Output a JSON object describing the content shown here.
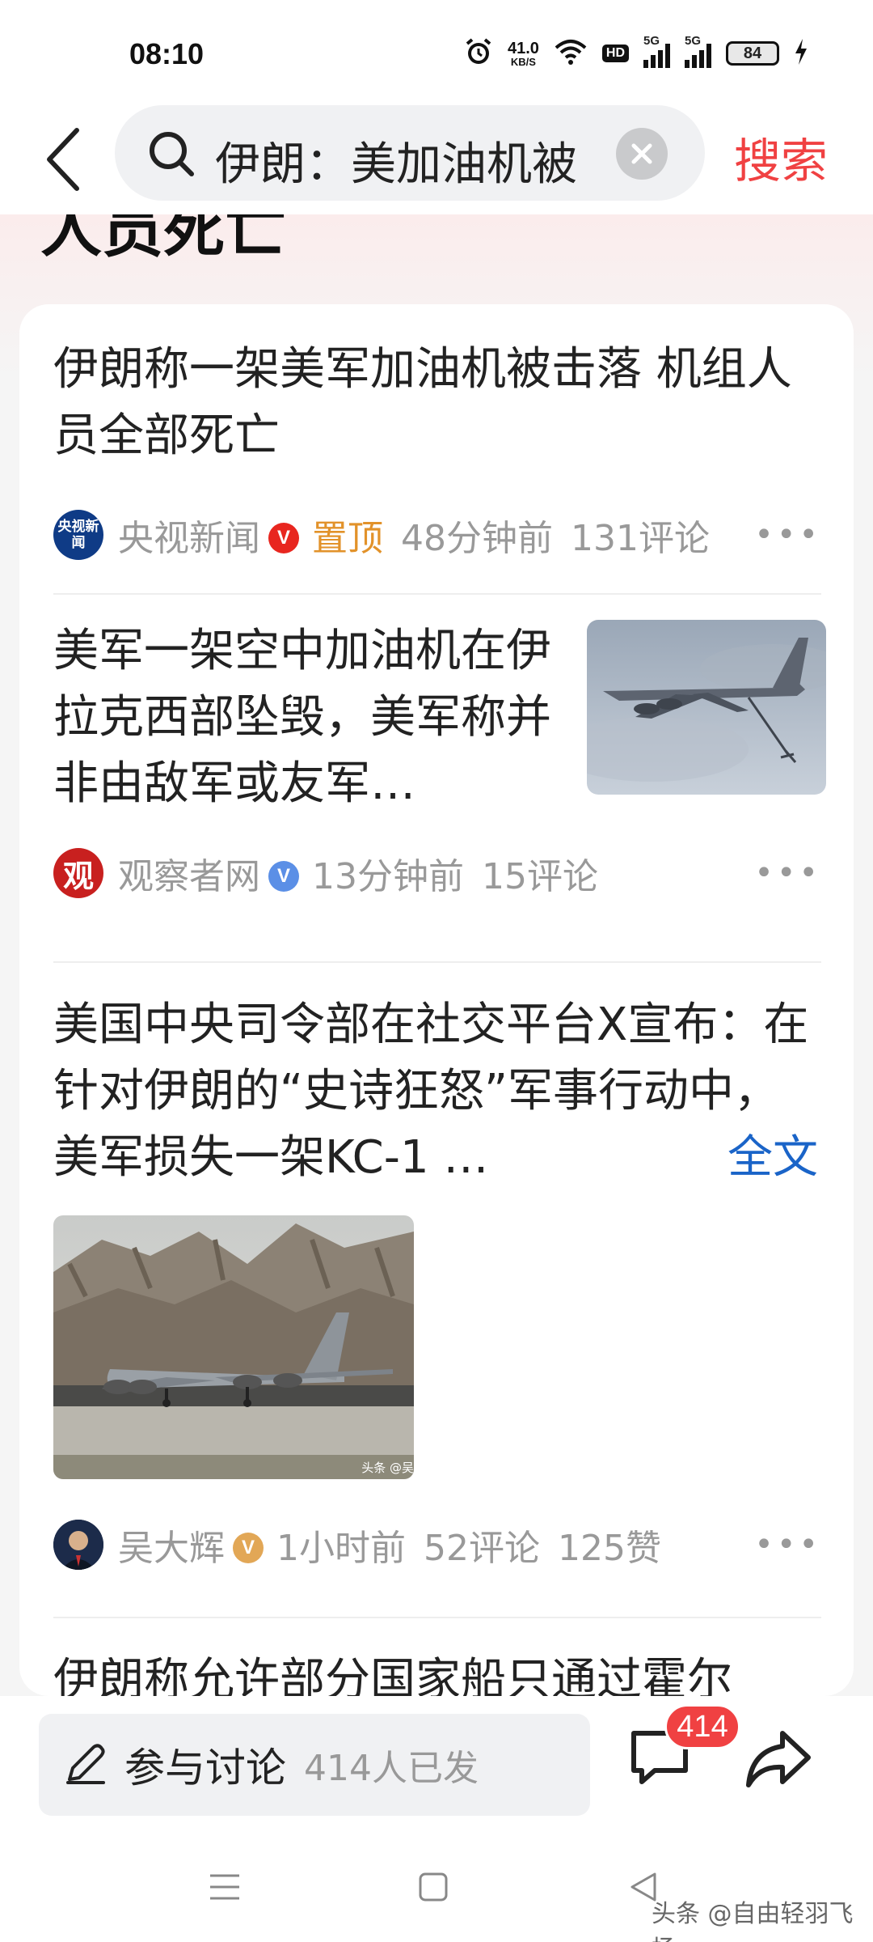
{
  "status_bar": {
    "time": "08:10",
    "net_speed_value": "41.0",
    "net_speed_unit": "KB/S",
    "hd_label": "HD",
    "sim1_label": "5G",
    "sim2_label": "5G",
    "battery": "84"
  },
  "search": {
    "query": "伊朗：美加油机被",
    "submit_label": "搜索"
  },
  "partial_heading": "人员死亡",
  "articles": [
    {
      "title": "伊朗称一架美军加油机被击落 机组人员全部死亡",
      "source": "央视新闻",
      "avatar_text": "央视新闻",
      "verified": "V",
      "pinned": "置顶",
      "time": "48分钟前",
      "comments": "131评论"
    },
    {
      "title": "美军一架空中加油机在伊拉克西部坠毁，美军称并非由敌军或友军…",
      "source": "观察者网",
      "avatar_text": "观",
      "verified": "V",
      "time": "13分钟前",
      "comments": "15评论"
    },
    {
      "title": "美国中央司令部在社交平台X宣布：在针对伊朗的“史诗狂怒”军事行动中，美军损失一架KC-1 …",
      "full_text_link": "全文",
      "source": "吴大辉",
      "verified": "V",
      "time": "1小时前",
      "comments": "52评论",
      "likes": "125赞",
      "image_watermark": "头条 @吴"
    },
    {
      "title": "伊朗称允许部分国家船只通过霍尔"
    }
  ],
  "bottom_bar": {
    "discuss_label": "参与讨论",
    "discuss_count": "414人已发",
    "comment_badge": "414"
  },
  "watermark": "头条 @自由轻羽飞扬",
  "colors": {
    "accent": "#f04142",
    "link": "#1a64c8",
    "pinned": "#e2922a",
    "meta": "#999999"
  }
}
